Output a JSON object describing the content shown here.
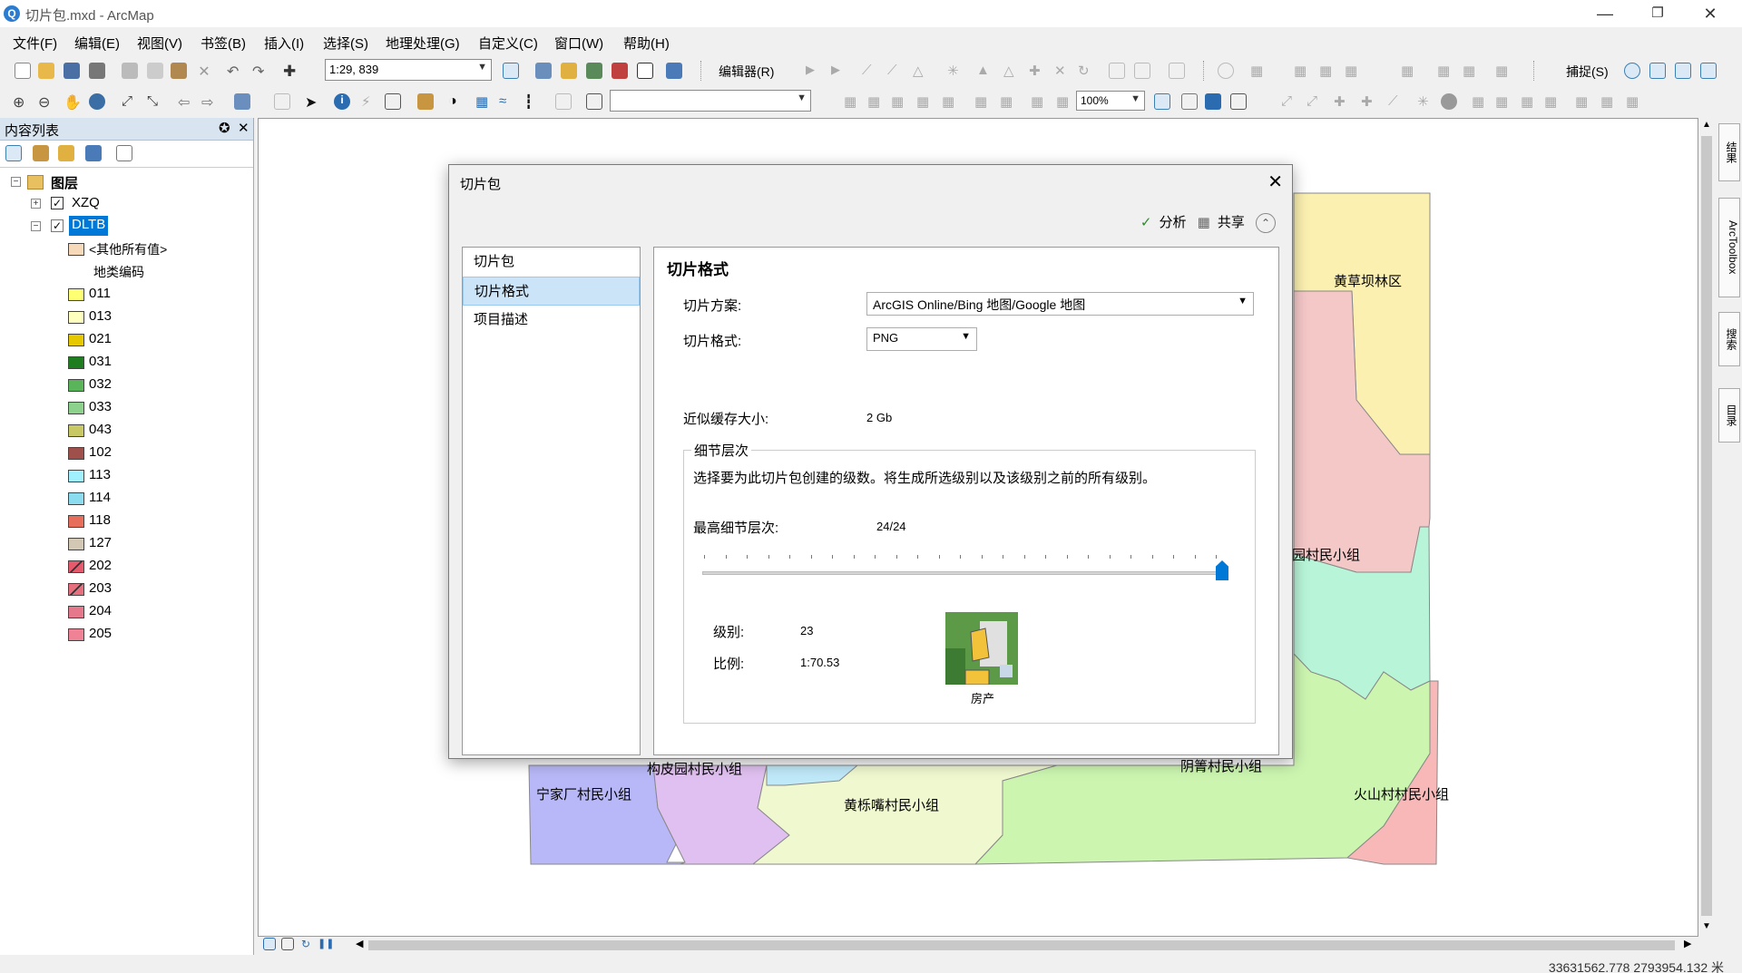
{
  "window": {
    "title": "切片包.mxd - ArcMap"
  },
  "menu": [
    "文件(F)",
    "编辑(E)",
    "视图(V)",
    "书签(B)",
    "插入(I)",
    "选择(S)",
    "地理处理(G)",
    "自定义(C)",
    "窗口(W)",
    "帮助(H)"
  ],
  "toolbar": {
    "scale": "1:29, 839",
    "editor_label": "编辑器(R)",
    "snapping_label": "捕捉(S)",
    "zoom_percent": "100%"
  },
  "toc": {
    "title": "内容列表",
    "root_label": "图层",
    "layers": [
      {
        "name": "XZQ",
        "checked": true,
        "expanded": false
      },
      {
        "name": "DLTB",
        "checked": true,
        "expanded": true,
        "selected": true
      }
    ],
    "other_values_label": "<其他所有值>",
    "field_label": "地类编码",
    "legend": [
      {
        "code": "011",
        "color": "#ffff73"
      },
      {
        "code": "013",
        "color": "#ffffbe"
      },
      {
        "code": "021",
        "color": "#e6c800"
      },
      {
        "code": "031",
        "color": "#1e7d1e"
      },
      {
        "code": "032",
        "color": "#5ab45a"
      },
      {
        "code": "033",
        "color": "#8cd28c"
      },
      {
        "code": "043",
        "color": "#c8c864"
      },
      {
        "code": "102",
        "color": "#a0504b"
      },
      {
        "code": "113",
        "color": "#a0f0ff"
      },
      {
        "code": "114",
        "color": "#8cdcf0"
      },
      {
        "code": "118",
        "color": "#e66e5a"
      },
      {
        "code": "127",
        "color": "#d2c8b4"
      },
      {
        "code": "202",
        "color": "#e65a6e"
      },
      {
        "code": "203",
        "color": "#e66e7d"
      },
      {
        "code": "204",
        "color": "#e6788c"
      },
      {
        "code": "205",
        "color": "#f08296"
      }
    ]
  },
  "map_labels": {
    "l1": "黄草坝林区",
    "l2": "园村民小组",
    "l3": "宁家厂村民小组",
    "l4": "构皮园村民小组",
    "l5": "黄栎嘴村民小组",
    "l6": "阴箐村民小组",
    "l7": "火山村村民小组"
  },
  "dialog": {
    "title": "切片包",
    "analyze_label": "分析",
    "share_label": "共享",
    "nav": [
      "切片包",
      "切片格式",
      "项目描述"
    ],
    "selected_nav": 1,
    "heading": "切片格式",
    "scheme_label": "切片方案:",
    "scheme_value": "ArcGIS Online/Bing 地图/Google 地图",
    "format_label": "切片格式:",
    "format_value": "PNG",
    "cache_label": "近似缓存大小:",
    "cache_value": "2 Gb",
    "lod_group": "细节层次",
    "lod_desc": "选择要为此切片包创建的级数。将生成所选级别以及该级别之前的所有级别。",
    "max_lod_label": "最高细节层次:",
    "max_lod_value": "24/24",
    "max_lod_fraction": 1.0,
    "level_label": "级别:",
    "level_value": "23",
    "scale_label": "比例:",
    "scale_value": "1:70.53",
    "preview_caption": "房产"
  },
  "status": {
    "coords": "33631562.778  2793954.132 米"
  },
  "dock_tabs": [
    "结果",
    "ArcToolbox",
    "搜索",
    "目录"
  ]
}
